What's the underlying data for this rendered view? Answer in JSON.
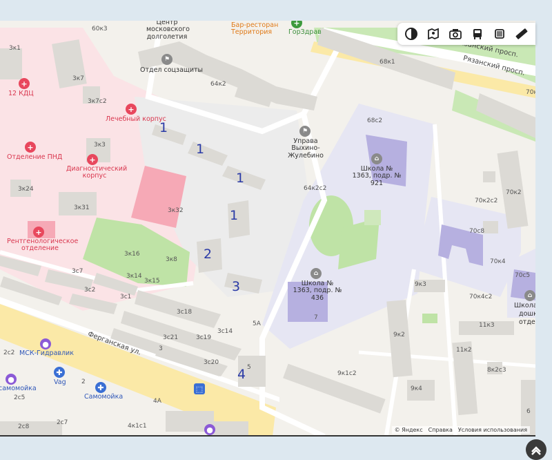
{
  "map": {
    "labels": {
      "b60k3": "60к3",
      "b3k1": "3к1",
      "b3k7": "3к7",
      "b3k7c2": "3к7с2",
      "b3k3": "3к3",
      "b3k24": "3к24",
      "b3k31": "3к31",
      "b3k32": "3к32",
      "b3k16": "3к16",
      "b3k8": "3к8",
      "b3k14": "3к14",
      "b3k15": "3к15",
      "b3c7": "3с7",
      "b3c2": "3с2",
      "b3c1": "3с1",
      "b3c18": "3с18",
      "b3c21": "3с21",
      "b3c19": "3с19",
      "b3c14": "3с14",
      "b3c20": "3с20",
      "b5": "5",
      "b5a": "5А",
      "b3": "3",
      "b2": "2",
      "b2c2": "2с2",
      "b2c5": "2с5",
      "b2c7": "2с7",
      "b2c8": "2с8",
      "b4a": "4А",
      "b4k1c1": "4к1с1",
      "b64k2": "64к2",
      "b64k2c2": "64к2с2",
      "b68k1": "68к1",
      "b68c2": "68с2",
      "b70k2": "70к2",
      "b70k2c2": "70к2с2",
      "b70c8": "70с8",
      "b70k4": "70к4",
      "b70c5": "70с5",
      "b70k4c2": "70к4с2",
      "b9k3": "9к3",
      "b9k2": "9к2",
      "b9k1c2": "9к1с2",
      "b9k4": "9к4",
      "b11k3": "11к3",
      "b11k2": "11к2",
      "b8k2c3": "8к2с3",
      "b70k": "70к",
      "b7": "7",
      "b6": "6"
    },
    "pois": {
      "kdc": "12 КДЦ",
      "lech": "Лечебный корпус",
      "pnd": "Отделение ПНД",
      "diag": "Диагностический корпус",
      "rentgen": "Рентгенологическое отделение",
      "center": "Центр московского долголетия",
      "socz": "Отдел соцзащиты",
      "bar": "Бар-ресторан Территория",
      "gorzdrav": "ГорЗдрав",
      "uprava": "Управа Выхино-Жулебино",
      "school921": "Школа № 1363, подр. № 921",
      "school436": "Школа № 1363, подр. № 436",
      "school_r1": "Школа",
      "school_r2": "дошко",
      "school_r3": "отдел",
      "msk": "МСК-Гидравлик",
      "vag": "Vag",
      "samomoyka": "Самомойка",
      "samomoyka2": "самомойка"
    },
    "streets": {
      "ryazan1": "Рязанский просп.",
      "ryazan2": "Рязанский просп.",
      "fergan": "Ферганская ул."
    },
    "markers": [
      "1",
      "1",
      "1",
      "1",
      "2",
      "3",
      "4"
    ]
  },
  "toolbar": {
    "buttons": [
      "layers-icon",
      "panorama-icon",
      "camera-icon",
      "transit-icon",
      "square-icon",
      "ruler-icon"
    ]
  },
  "footer": {
    "copyright": "© Яндекс",
    "help": "Справка",
    "terms": "Условия использования"
  },
  "colors": {
    "hospital": "#fbe3e6",
    "school": "#e5e5f3",
    "park": "#bfe3a6",
    "road": "#ffffff",
    "arterial": "#fbe9a7",
    "marker": "#2a3aa6"
  }
}
